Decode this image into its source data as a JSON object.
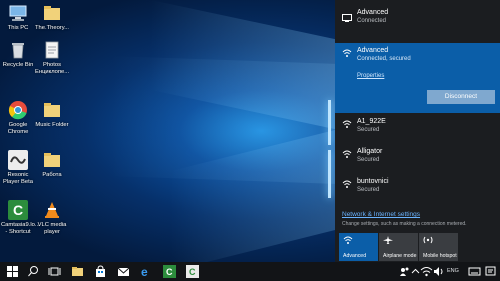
{
  "desktop": {
    "icons": [
      {
        "label": "This PC",
        "icon": "computer-icon",
        "color": "#7bb6e8"
      },
      {
        "label": "The.Theory...",
        "icon": "folder-icon",
        "color": "#f1d27a"
      },
      {
        "label": "Recycle Bin",
        "icon": "recycle-bin-icon",
        "color": "#d9dde2"
      },
      {
        "label": "Photos Енциклопе...",
        "icon": "document-icon",
        "color": "#f5f5f5"
      },
      {
        "label": "Google Chrome",
        "icon": "chrome-icon",
        "color": "#e74c3c"
      },
      {
        "label": "Music Folder",
        "icon": "folder-icon",
        "color": "#f1d27a"
      },
      {
        "label": "Resonic Player Beta",
        "icon": "resonic-icon",
        "color": "#ececec"
      },
      {
        "label": "Работа",
        "icon": "folder-icon",
        "color": "#f1d27a"
      },
      {
        "label": "Camtasia9.lo... - Shortcut",
        "icon": "camtasia-icon",
        "color": "#2c8c3c"
      },
      {
        "label": "VLC media player",
        "icon": "vlc-icon",
        "color": "#f08a1c"
      }
    ]
  },
  "flyout": {
    "connected_top": {
      "name": "Advanced",
      "status": "Connected",
      "icon": "ethernet-icon"
    },
    "selected": {
      "name": "Advanced",
      "status": "Connected, secured",
      "properties": "Properties",
      "disconnect": "Disconnect",
      "icon": "wifi-icon"
    },
    "networks": [
      {
        "name": "A1_922E",
        "status": "Secured",
        "icon": "wifi-icon"
      },
      {
        "name": "Alligator",
        "status": "Secured",
        "icon": "wifi-icon"
      },
      {
        "name": "buntovnici",
        "status": "Secured",
        "icon": "wifi-icon"
      }
    ],
    "settings_link": "Network & Internet settings",
    "settings_sub": "Change settings, such as making a connection metered.",
    "quick_actions": [
      {
        "label": "Advanced",
        "icon": "wifi-icon",
        "active": true
      },
      {
        "label": "Airplane mode",
        "icon": "airplane-icon",
        "active": false
      },
      {
        "label": "Mobile hotspot",
        "icon": "hotspot-icon",
        "active": false
      }
    ]
  },
  "taskbar": {
    "language": "ENG",
    "items": [
      "windows-start-icon",
      "search-icon",
      "task-view-icon",
      "file-explorer-icon",
      "store-icon",
      "mail-icon",
      "edge-icon",
      "camtasia-icon",
      "camtasia-recorder-icon"
    ],
    "tray": [
      "people-icon",
      "chevron-up-icon",
      "network-icon",
      "volume-icon",
      "keyboard-icon",
      "notification-icon"
    ]
  },
  "colors": {
    "accent": "#0b5ea8",
    "flyout_bg": "#1b1d20",
    "taskbar_bg": "#121417",
    "link": "#6ab3ff"
  }
}
